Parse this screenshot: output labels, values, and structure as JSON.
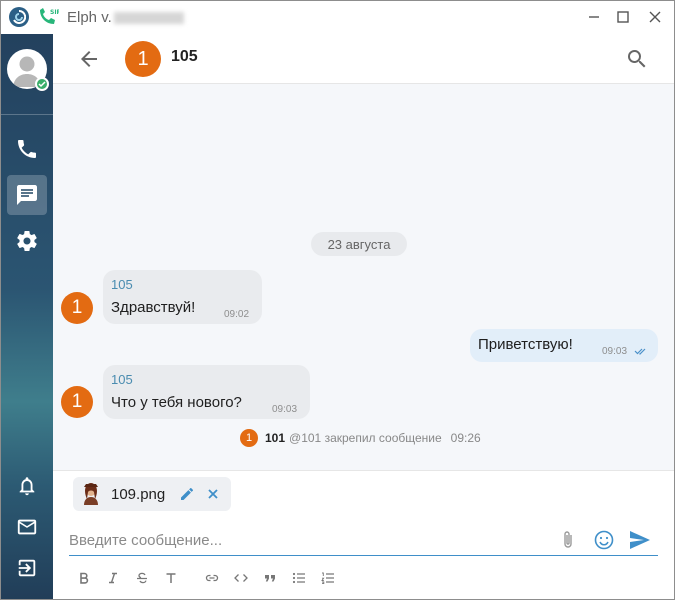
{
  "app": {
    "title_prefix": "Elph v.",
    "icons": {
      "logo": "app-logo-icon",
      "sip": "sip-phone-icon"
    }
  },
  "window_controls": {
    "minimize": "—",
    "maximize": "☐",
    "close": "✕"
  },
  "sidebar": {
    "items": [
      {
        "name": "phone-icon"
      },
      {
        "name": "chat-icon",
        "active": true
      },
      {
        "name": "settings-icon"
      },
      {
        "name": "bell-icon"
      },
      {
        "name": "mail-icon"
      },
      {
        "name": "logout-icon"
      }
    ]
  },
  "header": {
    "avatar_initial": "1",
    "title": "105"
  },
  "chat": {
    "date_separator": "23 августа",
    "messages": [
      {
        "direction": "in",
        "avatar": "1",
        "sender": "105",
        "text": "Здравствуй!",
        "time": "09:02"
      },
      {
        "direction": "out",
        "text": "Приветствую!",
        "time": "09:03",
        "read": true
      },
      {
        "direction": "in",
        "avatar": "1",
        "sender": "105",
        "text": "Что у тебя нового?",
        "time": "09:03"
      }
    ],
    "system": {
      "avatar": "1",
      "name": "101",
      "text": "@101 закрепил сообщение",
      "time": "09:26"
    }
  },
  "composer": {
    "attachment": {
      "filename": "109.png"
    },
    "placeholder": "Введите сообщение...",
    "format_toolbar": [
      "B",
      "I",
      "S",
      "T",
      "link",
      "code",
      "quote",
      "bullet-list",
      "numbered-list"
    ]
  },
  "colors": {
    "accent": "#3f8fc9",
    "avatar_orange": "#e36b12",
    "sidebar_top": "#23415e",
    "bubble_in": "#e9ebee",
    "bubble_out": "#e2eef9",
    "online_green": "#3aae6a"
  }
}
